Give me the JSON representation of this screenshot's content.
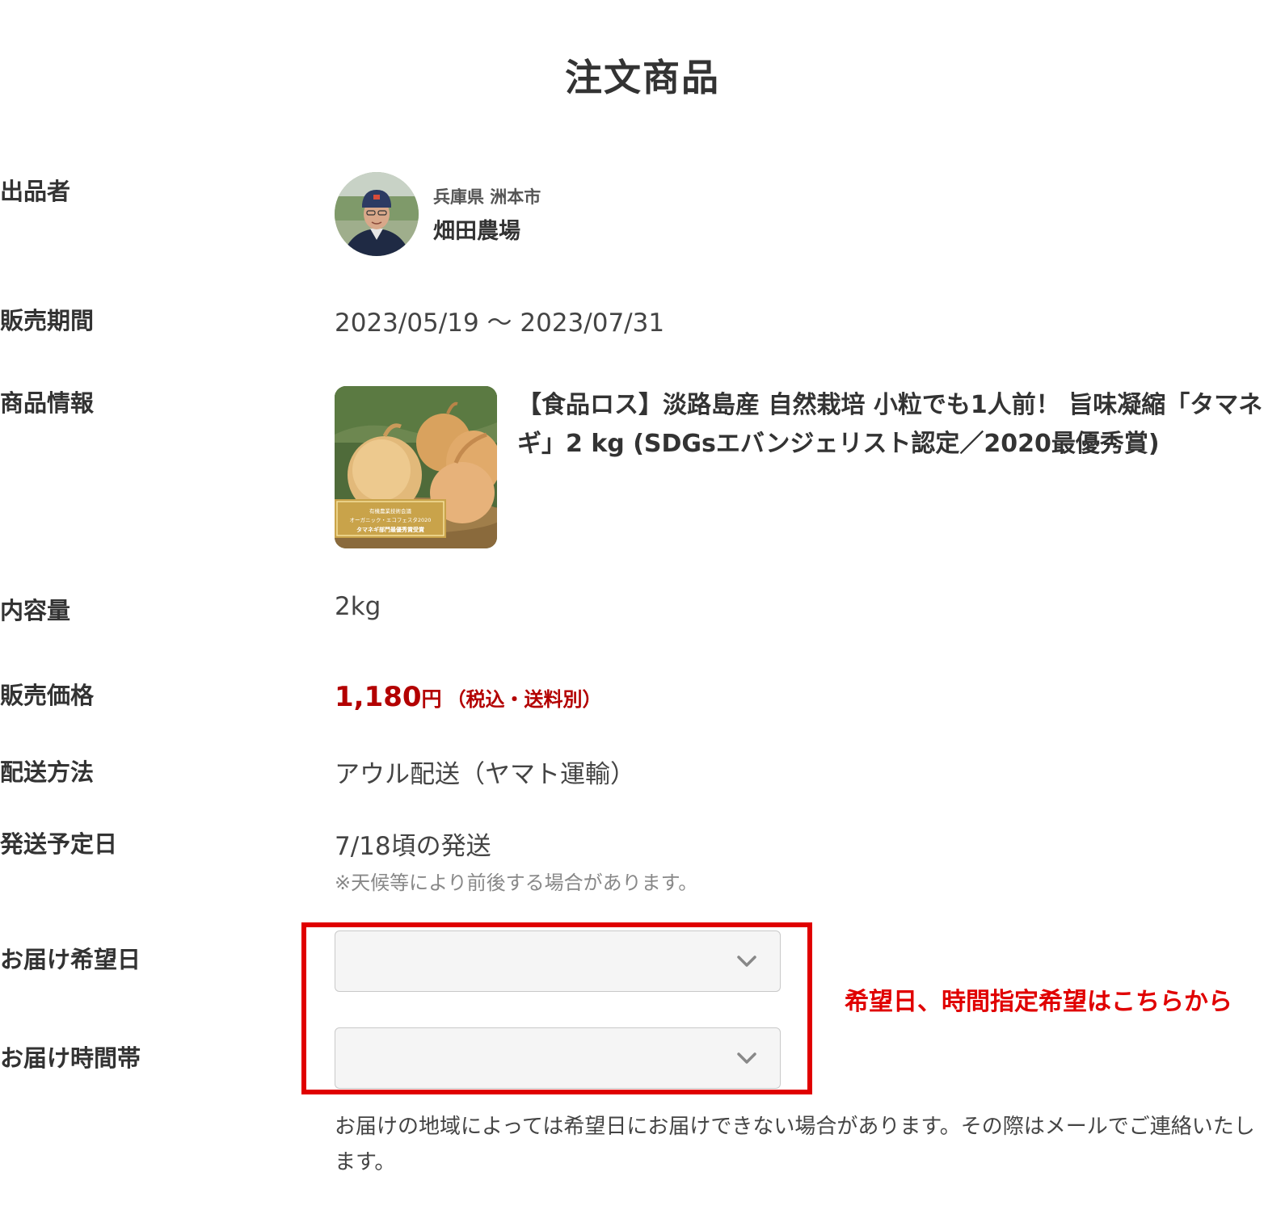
{
  "header": {
    "title": "注文商品"
  },
  "seller": {
    "label": "出品者",
    "region": "兵庫県 洲本市",
    "name": "畑田農場"
  },
  "sale_period": {
    "label": "販売期間",
    "value": "2023/05/19 ～ 2023/07/31"
  },
  "product": {
    "label": "商品情報",
    "title": "【食品ロス】淡路島産 自然栽培 小粒でも1人前！ 旨味凝縮「タマネギ」2 kg (SDGsエバンジェリスト認定／2020最優秀賞)",
    "badge_line1": "有機農業技術会議",
    "badge_line2": "オーガニック・エコフェスタ2020",
    "badge_line3": "タマネギ部門最優秀賞受賞"
  },
  "content_amount": {
    "label": "内容量",
    "value": "2kg"
  },
  "price": {
    "label": "販売価格",
    "amount": "1,180",
    "currency": "円",
    "note": "（税込・送料別）",
    "color": "#b30000"
  },
  "shipping_method": {
    "label": "配送方法",
    "value": "アウル配送（ヤマト運輸）"
  },
  "ship_date": {
    "label": "発送予定日",
    "value": "7/18頃の発送",
    "note": "※天候等により前後する場合があります。"
  },
  "delivery": {
    "date_label": "お届け希望日",
    "date_value": "",
    "time_label": "お届け時間帯",
    "time_value": "",
    "footnote": "お届けの地域によっては希望日にお届けできない場合があります。その際はメールでご連絡いたします。"
  },
  "annotation": {
    "text": "希望日、時間指定希望はこちらから",
    "color": "#e00000"
  }
}
